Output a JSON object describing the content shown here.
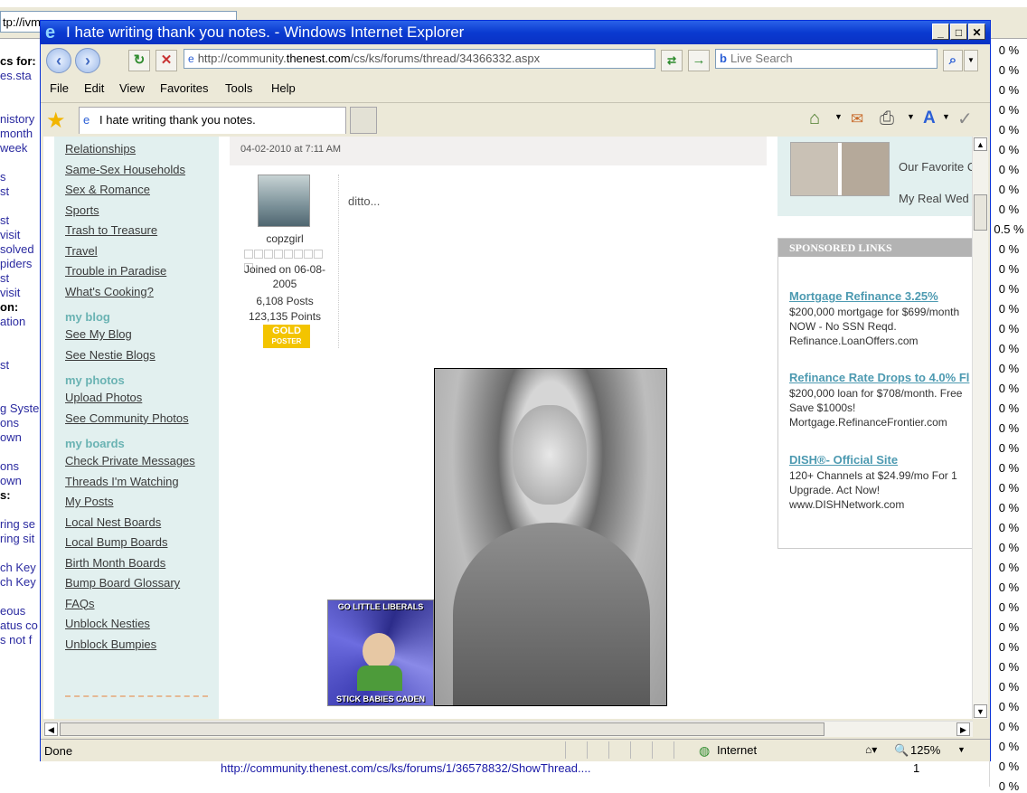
{
  "background_app": {
    "address_fragment": "tp://ivm",
    "left_lines": [
      {
        "text": "cs for:",
        "bold": true
      },
      {
        "text": "es.sta",
        "bold": false
      },
      {
        "text": "",
        "bold": false
      },
      {
        "text": "",
        "bold": false
      },
      {
        "text": "nistory",
        "bold": false
      },
      {
        "text": "month",
        "bold": false
      },
      {
        "text": "week",
        "bold": false
      },
      {
        "text": "",
        "bold": false
      },
      {
        "text": "s",
        "bold": false
      },
      {
        "text": "st",
        "bold": false
      },
      {
        "text": "",
        "bold": false
      },
      {
        "text": "st",
        "bold": false
      },
      {
        "text": "visit",
        "bold": false
      },
      {
        "text": "solved",
        "bold": false
      },
      {
        "text": "piders",
        "bold": false
      },
      {
        "text": "st",
        "bold": false
      },
      {
        "text": "visit",
        "bold": false
      },
      {
        "text": "on:",
        "bold": true
      },
      {
        "text": "ation",
        "bold": false
      },
      {
        "text": "",
        "bold": false
      },
      {
        "text": "",
        "bold": false
      },
      {
        "text": "st",
        "bold": false
      },
      {
        "text": "",
        "bold": false
      },
      {
        "text": "",
        "bold": false
      },
      {
        "text": "g Syste",
        "bold": false
      },
      {
        "text": "ons",
        "bold": false
      },
      {
        "text": "own",
        "bold": false
      },
      {
        "text": "",
        "bold": false
      },
      {
        "text": "ons",
        "bold": false
      },
      {
        "text": "own",
        "bold": false
      },
      {
        "text": "s:",
        "bold": true
      },
      {
        "text": "",
        "bold": false
      },
      {
        "text": "ring se",
        "bold": false
      },
      {
        "text": "ring sit",
        "bold": false
      },
      {
        "text": "",
        "bold": false
      },
      {
        "text": "ch Key",
        "bold": false
      },
      {
        "text": "ch Key",
        "bold": false
      },
      {
        "text": "",
        "bold": false
      },
      {
        "text": "eous",
        "bold": false
      },
      {
        "text": "atus co",
        "bold": false
      },
      {
        "text": "s not f",
        "bold": false
      }
    ],
    "percent_values": [
      "0 %",
      "0 %",
      "0 %",
      "0 %",
      "0 %",
      "0 %",
      "0 %",
      "0 %",
      "0 %",
      "0.5 %",
      "0 %",
      "0 %",
      "0 %",
      "0 %",
      "0 %",
      "0 %",
      "0 %",
      "0 %",
      "0 %",
      "0 %",
      "0 %",
      "0 %",
      "0 %",
      "0 %",
      "0 %",
      "0 %",
      "0 %",
      "0 %",
      "0 %",
      "0 %",
      "0 %",
      "0 %",
      "0 %",
      "0 %",
      "0 %",
      "0 %",
      "0 %",
      "0 %"
    ],
    "bottom_row": {
      "url": "http://community.thenest.com/cs/ks/forums/1/36578832/ShowThread....",
      "count": "1"
    }
  },
  "window": {
    "title": "I hate writing thank you notes. - Windows Internet Explorer",
    "minimize": "_",
    "maximize": "□",
    "close": "✕"
  },
  "nav": {
    "back_icon": "back-arrow-icon",
    "forward_icon": "forward-arrow-icon",
    "refresh_icon": "refresh-icon",
    "stop_icon": "stop-icon",
    "address_prefix": "http://community.",
    "address_host": "thenest.com",
    "address_suffix": "/cs/ks/forums/thread/34366332.aspx",
    "search_placeholder": "Live Search"
  },
  "menu": {
    "items": [
      "File",
      "Edit",
      "View",
      "Favorites",
      "Tools",
      "Help"
    ]
  },
  "tab": {
    "title": "I hate writing thank you notes."
  },
  "left_nav": {
    "links_top": [
      "Relationships",
      "Same-Sex Households",
      "Sex & Romance",
      "Sports",
      "Trash to Treasure",
      "Travel",
      "Trouble in Paradise",
      "What's Cooking?"
    ],
    "blog_head": "my blog",
    "blog_links": [
      "See My Blog",
      "See Nestie Blogs"
    ],
    "photos_head": "my photos",
    "photos_links": [
      "Upload Photos",
      "See Community Photos"
    ],
    "boards_head": "my boards",
    "boards_links": [
      "Check Private Messages",
      "Threads I'm Watching",
      "My Posts",
      "Local Nest Boards",
      "Local Bump Boards",
      "Birth Month Boards",
      "Bump Board Glossary",
      "FAQs",
      "Unblock Nesties",
      "Unblock Bumpies"
    ]
  },
  "post": {
    "date": "04-02-2010 at 7:11 AM",
    "username": "copzgirl",
    "joined_label": "Joined on 06-08-",
    "joined_year": "2005",
    "posts": "6,108 Posts",
    "points": "123,135 Points",
    "badge_line1": "GOLD",
    "badge_line2": "POSTER",
    "text": "ditto...",
    "meme_top": "GO LITTLE LIBERALS",
    "meme_bottom": "STICK BABIES CADEN"
  },
  "right_col": {
    "wedding_link1": "Our Favorite C",
    "wedding_link2": "My Real Wed",
    "sponsored_head": "SPONSORED LINKS",
    "ads": [
      {
        "title": "Mortgage Refinance 3.25%",
        "lines": [
          "$200,000 mortgage for $699/month",
          "NOW - No SSN Reqd.",
          "Refinance.LoanOffers.com"
        ]
      },
      {
        "title": "Refinance Rate Drops to 4.0% Fl",
        "lines": [
          "$200,000 loan for $708/month. Free",
          "Save $1000s!",
          "Mortgage.RefinanceFrontier.com"
        ]
      },
      {
        "title": "DISH®- Official Site",
        "lines": [
          "120+ Channels at $24.99/mo For 1",
          "Upgrade. Act Now!",
          "www.DISHNetwork.com"
        ]
      }
    ]
  },
  "status": {
    "text": "Done",
    "zone": "Internet",
    "zoom": "125%"
  }
}
